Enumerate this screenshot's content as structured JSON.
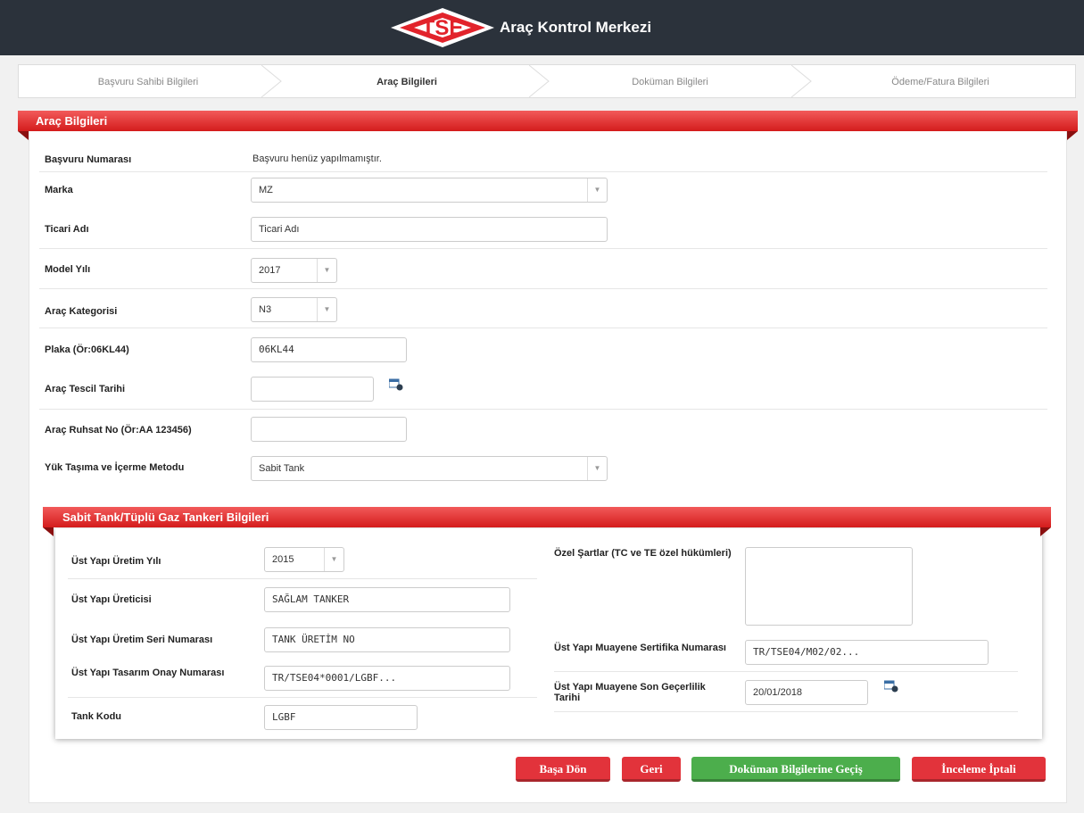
{
  "header": {
    "logo_text": "TSE",
    "title": "Araç Kontrol Merkezi"
  },
  "steps": [
    {
      "label": "Başvuru Sahibi Bilgileri"
    },
    {
      "label": "Araç Bilgileri"
    },
    {
      "label": "Doküman Bilgileri"
    },
    {
      "label": "Ödeme/Fatura Bilgileri"
    }
  ],
  "vehicle": {
    "section_title": "Araç Bilgileri",
    "application_number": {
      "label": "Başvuru Numarası",
      "value": "Başvuru henüz yapılmamıştır."
    },
    "brand": {
      "label": "Marka",
      "value": "MZ"
    },
    "trade_name": {
      "label": "Ticari Adı",
      "placeholder": "Ticari Adı"
    },
    "model_year": {
      "label": "Model Yılı",
      "value": "2017"
    },
    "category": {
      "label": "Araç Kategorisi",
      "value": "N3"
    },
    "plate": {
      "label": "Plaka (Ör:06KL44)",
      "value": "06KL44"
    },
    "registration_date": {
      "label": "Araç Tescil Tarihi",
      "value": ""
    },
    "license_no": {
      "label": "Araç Ruhsat No (Ör:AA 123456)",
      "value": ""
    },
    "transport_method": {
      "label": "Yük Taşıma ve İçerme Metodu",
      "value": "Sabit Tank"
    }
  },
  "tank": {
    "section_title": "Sabit Tank/Tüplü Gaz Tankeri Bilgileri",
    "production_year": {
      "label": "Üst Yapı Üretim Yılı",
      "value": "2015"
    },
    "manufacturer": {
      "label": "Üst Yapı Üreticisi",
      "value": "SAĞLAM TANKER"
    },
    "serial_no": {
      "label": "Üst Yapı Üretim Seri Numarası",
      "value": "TANK ÜRETİM NO"
    },
    "design_approval": {
      "label": "Üst Yapı Tasarım Onay Numarası",
      "value": "TR/TSE04*0001/LGBF..."
    },
    "tank_code": {
      "label": "Tank Kodu",
      "value": "LGBF"
    },
    "special_conditions": {
      "label": "Özel Şartlar (TC ve TE özel hükümleri)",
      "value": ""
    },
    "inspection_cert": {
      "label": "Üst Yapı Muayene Sertifika Numarası",
      "value": "TR/TSE04/M02/02..."
    },
    "inspection_validity": {
      "label": "Üst Yapı Muayene Son Geçerlilik Tarihi",
      "value": "20/01/2018"
    }
  },
  "buttons": {
    "start": "Başa Dön",
    "back": "Geri",
    "next": "Doküman Bilgilerine Geçiş",
    "cancel": "İnceleme İptali"
  },
  "colors": {
    "header_bg": "#2b323b",
    "ribbon_red": "#e02a2a",
    "button_red": "#e2333b",
    "button_green": "#4cae4c"
  }
}
